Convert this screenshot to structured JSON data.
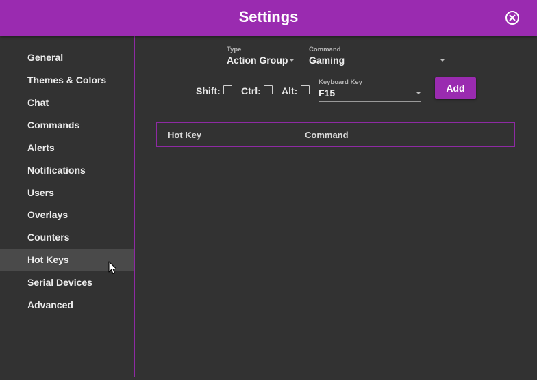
{
  "window": {
    "title": "Settings"
  },
  "sidebar": {
    "items": [
      {
        "label": "General"
      },
      {
        "label": "Themes & Colors"
      },
      {
        "label": "Chat"
      },
      {
        "label": "Commands"
      },
      {
        "label": "Alerts"
      },
      {
        "label": "Notifications"
      },
      {
        "label": "Users"
      },
      {
        "label": "Overlays"
      },
      {
        "label": "Counters"
      },
      {
        "label": "Hot Keys",
        "active": true
      },
      {
        "label": "Serial Devices"
      },
      {
        "label": "Advanced"
      }
    ]
  },
  "form": {
    "type": {
      "label": "Type",
      "value": "Action Group"
    },
    "command": {
      "label": "Command",
      "value": "Gaming"
    },
    "modifiers": {
      "shift": "Shift:",
      "ctrl": "Ctrl:",
      "alt": "Alt:"
    },
    "keyboard_key": {
      "label": "Keyboard Key",
      "value": "F15"
    },
    "add_label": "Add"
  },
  "table": {
    "columns": [
      "Hot Key",
      "Command"
    ],
    "rows": []
  },
  "colors": {
    "accent": "#9a2bb0",
    "background": "#323232",
    "active_item": "#4a4a4a"
  },
  "icons": {
    "close": "close-circle-icon",
    "dropdown": "chevron-down-icon",
    "cursor": "mouse-pointer-icon"
  }
}
